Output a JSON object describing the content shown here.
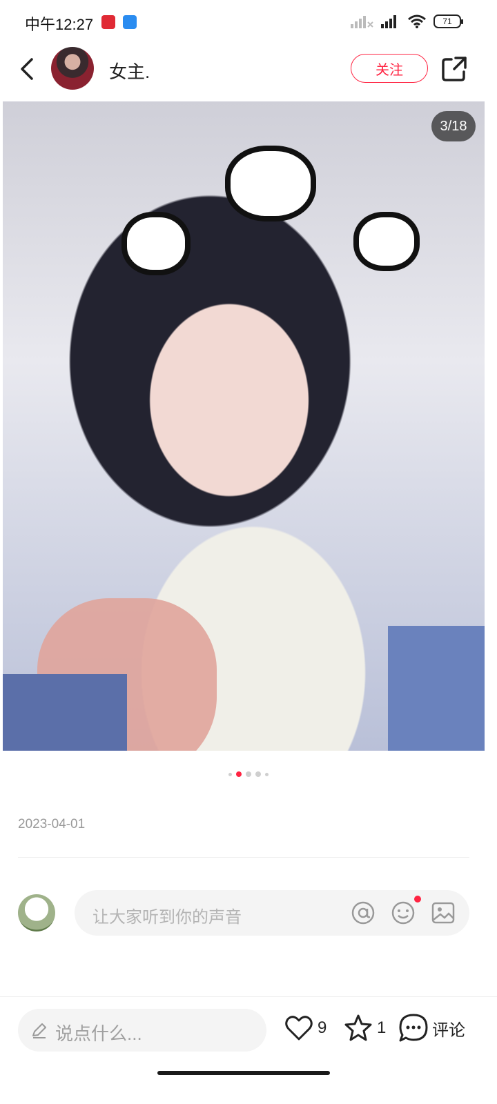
{
  "status_bar": {
    "time": "中午12:27",
    "battery": "71",
    "icons": [
      "app-notification-icon",
      "app-notification-icon",
      "signal-icon",
      "signal-icon",
      "wifi-icon",
      "battery-icon"
    ]
  },
  "header": {
    "username": "女主.",
    "follow_label": "关注",
    "icons": [
      "back-icon",
      "share-icon"
    ]
  },
  "media": {
    "page_counter": "3/18",
    "carousel_dots": 5,
    "active_dot_index": 1
  },
  "post": {
    "date": "2023-04-01"
  },
  "comment_input": {
    "placeholder": "让大家听到你的声音",
    "icons": [
      "at-icon",
      "emoji-icon",
      "image-icon"
    ]
  },
  "bottom_bar": {
    "say_placeholder": "说点什么...",
    "like_count": "9",
    "collect_count": "1",
    "comment_label": "评论"
  },
  "colors": {
    "accent": "#ff2442",
    "muted_text": "#999999",
    "input_bg": "#f4f4f4"
  }
}
